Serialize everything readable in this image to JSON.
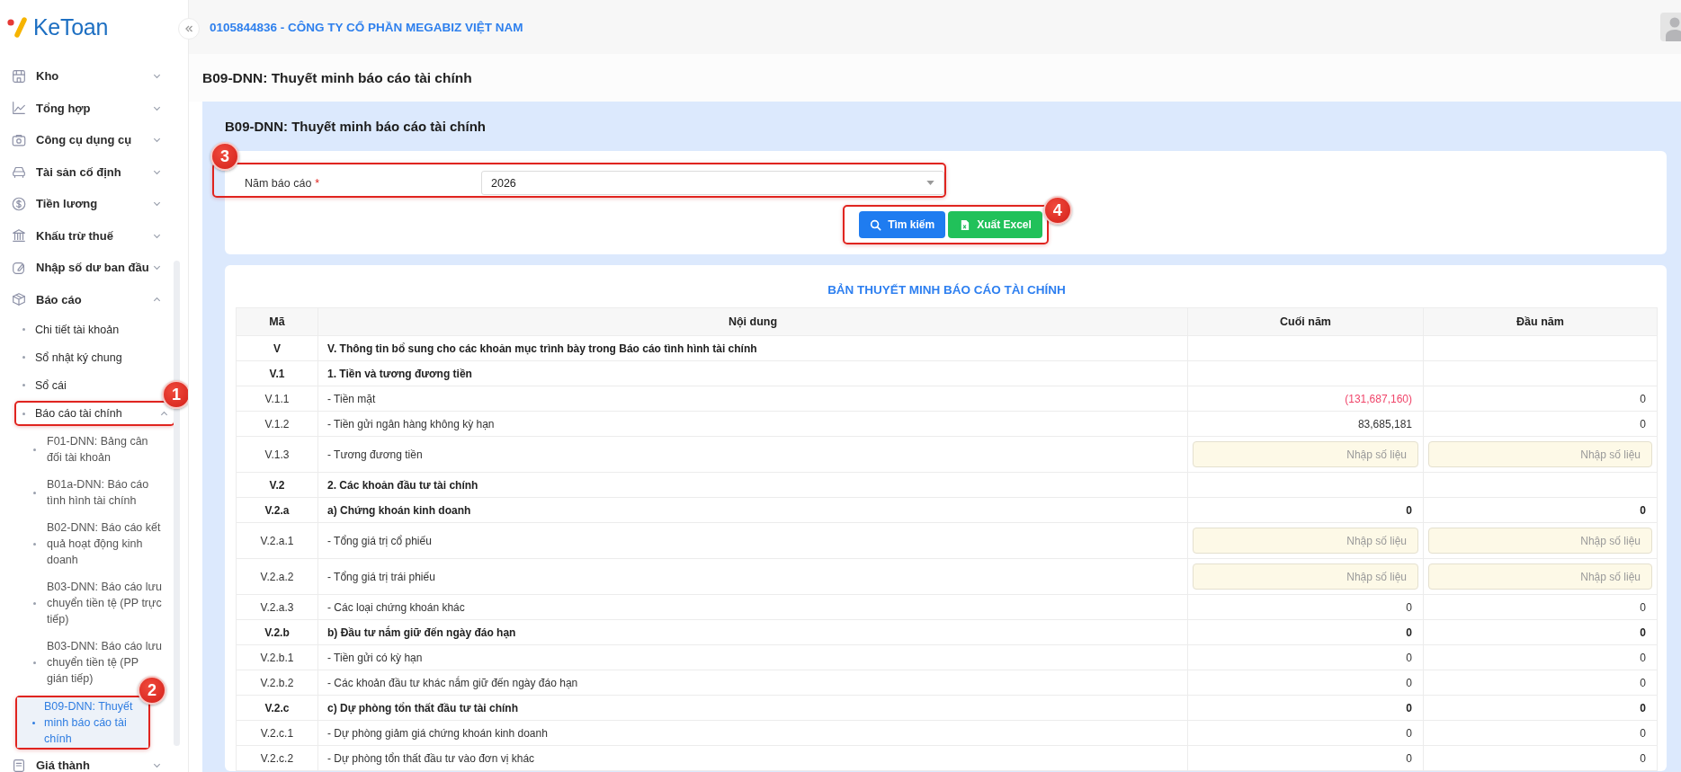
{
  "logo": {
    "text": "KeToan"
  },
  "sidebar": {
    "items": [
      {
        "label": "Kho",
        "expanded": false
      },
      {
        "label": "Tổng hợp",
        "expanded": false
      },
      {
        "label": "Công cụ dụng cụ",
        "expanded": false
      },
      {
        "label": "Tài sản cố định",
        "expanded": false
      },
      {
        "label": "Tiền lương",
        "expanded": false
      },
      {
        "label": "Khấu trừ thuế",
        "expanded": false
      },
      {
        "label": "Nhập số dư ban đầu",
        "expanded": false
      },
      {
        "label": "Báo cáo",
        "expanded": true,
        "children": [
          {
            "label": "Chi tiết tài khoản",
            "selected": false
          },
          {
            "label": "Sổ nhật ký chung",
            "selected": false
          },
          {
            "label": "Sổ cái",
            "selected": false
          },
          {
            "label": "Báo cáo tài chính",
            "expanded": true,
            "callout": "1",
            "children": [
              {
                "label": "F01-DNN: Bảng cân đối tài khoản",
                "selected": false
              },
              {
                "label": "B01a-DNN: Báo cáo tình hình tài chính",
                "selected": false
              },
              {
                "label": "B02-DNN: Báo cáo kết quả hoạt động kinh doanh",
                "selected": false
              },
              {
                "label": "B03-DNN: Báo cáo lưu chuyển tiền tệ (PP trực tiếp)",
                "selected": false
              },
              {
                "label": "B03-DNN: Báo cáo lưu chuyển tiền tệ (PP gián tiếp)",
                "selected": false
              },
              {
                "label": "B09-DNN: Thuyết minh báo cáo tài chính",
                "selected": true,
                "callout": "2"
              }
            ]
          }
        ]
      },
      {
        "label": "Giá thành",
        "expanded": false
      }
    ]
  },
  "header": {
    "company": "0105844836 - CÔNG TY CỔ PHẦN MEGABIZ VIỆT NAM"
  },
  "page_title": "B09-DNN: Thuyết minh báo cáo tài chính",
  "panel": {
    "title": "B09-DNN: Thuyết minh báo cáo tài chính",
    "form": {
      "label": "Năm báo cáo",
      "required_mark": "*",
      "value": "2026",
      "callout": "3"
    },
    "buttons_callout": "4",
    "buttons": [
      {
        "kind": "search",
        "label": "Tìm kiếm"
      },
      {
        "kind": "excel",
        "label": "Xuất Excel"
      }
    ]
  },
  "report": {
    "title": "BẢN THUYẾT MINH BÁO CÁO TÀI CHÍNH",
    "columns": [
      "Mã",
      "Nội dung",
      "Cuối năm",
      "Đầu năm"
    ],
    "rows": [
      {
        "kind": "section",
        "code": "V",
        "content": "V. Thông tin bổ sung cho các khoản mục trình bày trong Báo cáo tình hình tài chính"
      },
      {
        "kind": "section",
        "code": "V.1",
        "content": "1. Tiền và tương đương tiền"
      },
      {
        "kind": "item",
        "code": "V.1.1",
        "content": "- Tiền mặt",
        "end": {
          "kind": "value",
          "text": "(131,687,160)",
          "negative": true
        },
        "start": {
          "kind": "value",
          "text": "0",
          "negative": false
        }
      },
      {
        "kind": "item",
        "code": "V.1.2",
        "content": "- Tiền gửi ngân hàng không kỳ hạn",
        "end": {
          "kind": "value",
          "text": "83,685,181",
          "negative": false
        },
        "start": {
          "kind": "value",
          "text": "0",
          "negative": false
        }
      },
      {
        "kind": "item",
        "code": "V.1.3",
        "content": "- Tương đương tiền",
        "end": {
          "kind": "input",
          "placeholder": "Nhập số liệu"
        },
        "start": {
          "kind": "input",
          "placeholder": "Nhập số liệu"
        }
      },
      {
        "kind": "section",
        "code": "V.2",
        "content": "2. Các khoản đầu tư tài chính"
      },
      {
        "kind": "section",
        "code": "V.2.a",
        "content": "a) Chứng khoán kinh doanh",
        "end": {
          "kind": "value",
          "text": "0",
          "negative": false
        },
        "start": {
          "kind": "value",
          "text": "0",
          "negative": false
        }
      },
      {
        "kind": "item",
        "code": "V.2.a.1",
        "content": "- Tổng giá trị cổ phiếu",
        "end": {
          "kind": "input",
          "placeholder": "Nhập số liệu"
        },
        "start": {
          "kind": "input",
          "placeholder": "Nhập số liệu"
        }
      },
      {
        "kind": "item",
        "code": "V.2.a.2",
        "content": "- Tổng giá trị trái phiếu",
        "end": {
          "kind": "input",
          "placeholder": "Nhập số liệu"
        },
        "start": {
          "kind": "input",
          "placeholder": "Nhập số liệu"
        }
      },
      {
        "kind": "item",
        "code": "V.2.a.3",
        "content": "- Các loại chứng khoán khác",
        "end": {
          "kind": "value",
          "text": "0",
          "negative": false
        },
        "start": {
          "kind": "value",
          "text": "0",
          "negative": false
        }
      },
      {
        "kind": "section",
        "code": "V.2.b",
        "content": "b) Đầu tư nắm giữ đến ngày đáo hạn",
        "end": {
          "kind": "value",
          "text": "0",
          "negative": false
        },
        "start": {
          "kind": "value",
          "text": "0",
          "negative": false
        }
      },
      {
        "kind": "item",
        "code": "V.2.b.1",
        "content": "- Tiền gửi có kỳ hạn",
        "end": {
          "kind": "value",
          "text": "0",
          "negative": false
        },
        "start": {
          "kind": "value",
          "text": "0",
          "negative": false
        }
      },
      {
        "kind": "item",
        "code": "V.2.b.2",
        "content": "- Các khoản đầu tư khác nắm giữ đến ngày đáo hạn",
        "end": {
          "kind": "value",
          "text": "0",
          "negative": false
        },
        "start": {
          "kind": "value",
          "text": "0",
          "negative": false
        }
      },
      {
        "kind": "section",
        "code": "V.2.c",
        "content": "c) Dự phòng tổn thất đầu tư tài chính",
        "end": {
          "kind": "value",
          "text": "0",
          "negative": false
        },
        "start": {
          "kind": "value",
          "text": "0",
          "negative": false
        }
      },
      {
        "kind": "item",
        "code": "V.2.c.1",
        "content": "- Dự phòng giảm giá chứng khoán kinh doanh",
        "end": {
          "kind": "value",
          "text": "0",
          "negative": false
        },
        "start": {
          "kind": "value",
          "text": "0",
          "negative": false
        }
      },
      {
        "kind": "item",
        "code": "V.2.c.2",
        "content": "- Dự phòng tổn thất đầu tư vào đơn vị khác",
        "end": {
          "kind": "value",
          "text": "0",
          "negative": false
        },
        "start": {
          "kind": "value",
          "text": "0",
          "negative": false
        }
      }
    ]
  }
}
